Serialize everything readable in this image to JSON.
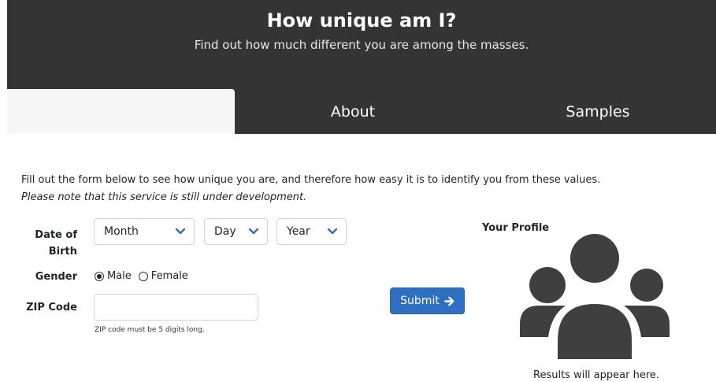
{
  "header": {
    "title": "How unique am I?",
    "subtitle": "Find out how much different you are among the masses."
  },
  "tabs": [
    {
      "label": ""
    },
    {
      "label": "About"
    },
    {
      "label": "Samples"
    }
  ],
  "form": {
    "intro": "Fill out the form below to see how unique you are, and therefore how easy it is to identify you from these values.",
    "note": "Please note that this service is still under development.",
    "dob_label_line1": "Date of",
    "dob_label_line2": "Birth",
    "month_value": "Month",
    "day_value": "Day",
    "year_value": "Year",
    "gender_label": "Gender",
    "gender_male": "Male",
    "gender_female": "Female",
    "gender_selected": "Male",
    "zip_label": "ZIP Code",
    "zip_value": "",
    "zip_help": "ZIP code must be 5 digits long.",
    "submit_label": "Submit"
  },
  "profile": {
    "title": "Your Profile",
    "results_text": "Results will appear here."
  },
  "colors": {
    "header_bg": "#343434",
    "submit_bg": "#2f6fc0",
    "icon": "#3f3f3f",
    "chevron": "#2f6fc0"
  }
}
